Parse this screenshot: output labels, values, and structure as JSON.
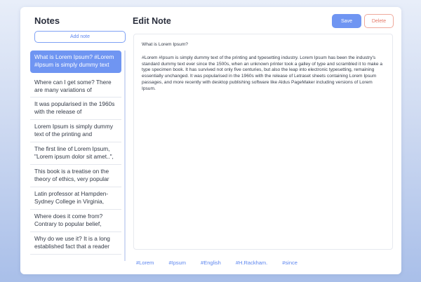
{
  "sidebar": {
    "title": "Notes",
    "add_label": "Add note",
    "notes": [
      {
        "text": "What is Lorem Ipsum? #Lorem #Ipsum is simply dummy text",
        "active": true
      },
      {
        "text": "Where can I get some? There are many variations of"
      },
      {
        "text": "It was popularised in the 1960s with the release of"
      },
      {
        "text": "Lorem Ipsum is simply dummy text of the printing and"
      },
      {
        "text": "The first line of Lorem Ipsum, \"Lorem ipsum dolor sit amet..\","
      },
      {
        "text": "This book is a treatise on the theory of ethics, very popular"
      },
      {
        "text": "Latin professor at Hampden-Sydney College in Virginia,"
      },
      {
        "text": "Where does it come from? Contrary to popular belief,"
      },
      {
        "text": "Why do we use it? It is a long established fact that a reader"
      }
    ]
  },
  "editor": {
    "title": "Edit Note",
    "save_label": "Save",
    "delete_label": "Delete",
    "heading_line": "What is Lorem Ipsum?",
    "body": "#Lorem #Ipsum is simply dummy text of the printing and typesetting industry. Lorem Ipsum has been the industry's standard dummy text ever since the 1500s, when an unknown printer took a galley of type and scrambled it to make a type specimen book. It has survived not only five centuries, but also the leap into electronic typesetting, remaining essentially unchanged. It was popularised in the 1960s with the release of Letraset sheets containing Lorem Ipsum passages, and more recently with desktop publishing software like Aldus PageMaker including versions of Lorem Ipsum."
  },
  "tags": [
    "#Lorem",
    "#Ipsum",
    "#English",
    "#H.Rackham.",
    "#since"
  ],
  "colors": {
    "accent": "#6f95f2",
    "delete": "#e57b6a"
  }
}
